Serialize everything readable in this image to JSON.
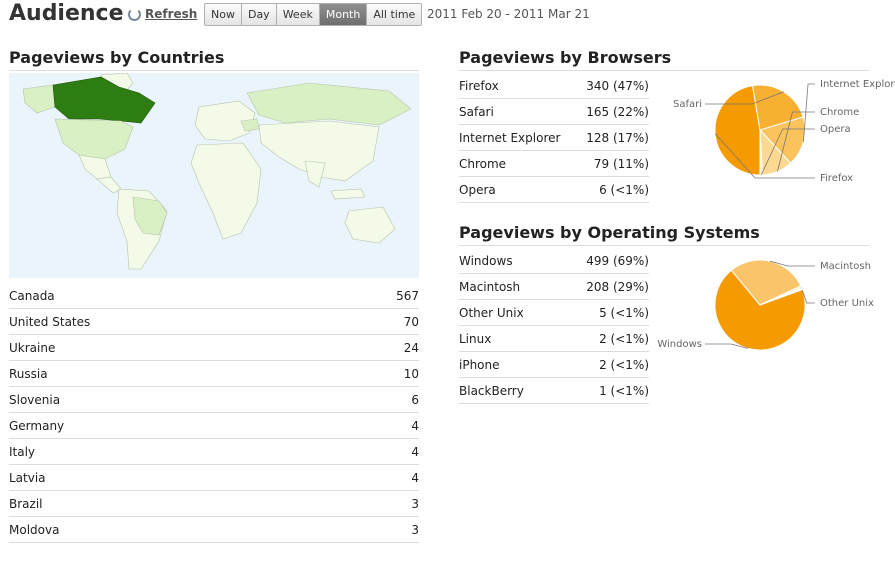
{
  "header": {
    "title": "Audience",
    "refresh_label": "Refresh",
    "ranges": [
      "Now",
      "Day",
      "Week",
      "Month",
      "All time"
    ],
    "active_range": "Month",
    "date_range": "2011 Feb 20 - 2011 Mar 21"
  },
  "countries": {
    "title": "Pageviews by Countries",
    "rows": [
      {
        "name": "Canada",
        "value": "567"
      },
      {
        "name": "United States",
        "value": "70"
      },
      {
        "name": "Ukraine",
        "value": "24"
      },
      {
        "name": "Russia",
        "value": "10"
      },
      {
        "name": "Slovenia",
        "value": "6"
      },
      {
        "name": "Germany",
        "value": "4"
      },
      {
        "name": "Italy",
        "value": "4"
      },
      {
        "name": "Latvia",
        "value": "4"
      },
      {
        "name": "Brazil",
        "value": "3"
      },
      {
        "name": "Moldova",
        "value": "3"
      }
    ]
  },
  "browsers": {
    "title": "Pageviews by Browsers",
    "rows": [
      {
        "name": "Firefox",
        "value": "340 (47%)"
      },
      {
        "name": "Safari",
        "value": "165 (22%)"
      },
      {
        "name": "Internet Explorer",
        "value": "128 (17%)"
      },
      {
        "name": "Chrome",
        "value": "79 (11%)"
      },
      {
        "name": "Opera",
        "value": "6 (<1%)"
      }
    ]
  },
  "os": {
    "title": "Pageviews by Operating Systems",
    "rows": [
      {
        "name": "Windows",
        "value": "499 (69%)"
      },
      {
        "name": "Macintosh",
        "value": "208 (29%)"
      },
      {
        "name": "Other Unix",
        "value": "5 (<1%)"
      },
      {
        "name": "Linux",
        "value": "2 (<1%)"
      },
      {
        "name": "iPhone",
        "value": "2 (<1%)"
      },
      {
        "name": "BlackBerry",
        "value": "1 (<1%)"
      }
    ]
  },
  "colors": {
    "map_ocean": "#eaf4fb",
    "map_land_low": "#f3fae8",
    "map_land_mid": "#d9f0c4",
    "map_land_high": "#2e7d12",
    "firefox": "#f59a00",
    "safari": "#f8b033",
    "internet_explorer": "#fbc35c",
    "chrome": "#fcd890",
    "opera": "#fde7b8",
    "windows": "#f59a00",
    "macintosh": "#f9c46a",
    "other_unix": "#fde7b8"
  },
  "chart_data": [
    {
      "type": "pie",
      "series": [
        {
          "name": "Firefox",
          "value": 340
        },
        {
          "name": "Safari",
          "value": 165
        },
        {
          "name": "Internet Explorer",
          "value": 128
        },
        {
          "name": "Chrome",
          "value": 79
        },
        {
          "name": "Opera",
          "value": 6
        }
      ],
      "labels": [
        "Firefox",
        "Safari",
        "Internet Explorer",
        "Chrome",
        "Opera"
      ]
    },
    {
      "type": "pie",
      "series": [
        {
          "name": "Windows",
          "value": 499
        },
        {
          "name": "Macintosh",
          "value": 208
        },
        {
          "name": "Other Unix",
          "value": 5
        },
        {
          "name": "Linux",
          "value": 2
        },
        {
          "name": "iPhone",
          "value": 2
        },
        {
          "name": "BlackBerry",
          "value": 1
        }
      ],
      "labels": [
        "Windows",
        "Macintosh",
        "Other Unix"
      ]
    }
  ]
}
